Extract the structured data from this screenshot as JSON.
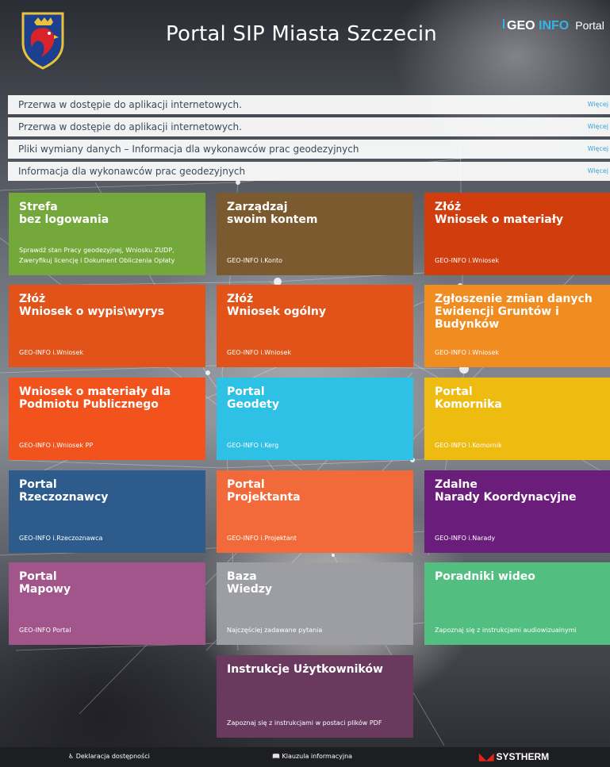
{
  "header": {
    "title": "Portal SIP Miasta Szczecin",
    "brand_geo": "GEO",
    "brand_info": "INFO",
    "brand_portal": "Portal",
    "crest_icon": "szczecin-crest-icon"
  },
  "news": [
    {
      "text": "Przerwa w dostępie do aplikacji internetowych.",
      "more": "Więcej"
    },
    {
      "text": "Przerwa w dostępie do aplikacji internetowych.",
      "more": "Więcej"
    },
    {
      "text": "Pliki wymiany danych – Informacja dla wykonawców prac geodezyjnych",
      "more": "Więcej"
    },
    {
      "text": "Informacja dla wykonawców prac geodezyjnych",
      "more": "Więcej"
    }
  ],
  "tiles": [
    {
      "title": "Strefa\nbez logowania",
      "sub": "Sprawdź stan Pracy geodezyjnej, Wniosku ZUDP, Zweryfikuj licencję i Dokument Obliczenia Opłaty",
      "color": "#74a83a"
    },
    {
      "title": "Zarządzaj\nswoim kontem",
      "sub": "GEO-INFO i.Konto",
      "color": "#7a5a2e"
    },
    {
      "title": "Złóż\nWniosek o materiały",
      "sub": "GEO-INFO i.Wniosek",
      "color": "#d23d0d"
    },
    {
      "title": "Złóż\nWniosek o wypis\\wyrys",
      "sub": "GEO-INFO i.Wniosek",
      "color": "#e2531a"
    },
    {
      "title": "Złóż\nWniosek ogólny",
      "sub": "GEO-INFO i.Wniosek",
      "color": "#e2531a"
    },
    {
      "title": "Zgłoszenie zmian danych\nEwidencji Gruntów i Budynków",
      "sub": "GEO-INFO i.Wniosek",
      "color": "#f08c20"
    },
    {
      "title": "Wniosek o materiały dla\nPodmiotu Publicznego",
      "sub": "GEO-INFO i.Wniosek PP",
      "color": "#f2531d"
    },
    {
      "title": "Portal\nGeodety",
      "sub": "GEO-INFO i.Kerg",
      "color": "#2fc0e6"
    },
    {
      "title": "Portal\nKomornika",
      "sub": "GEO-INFO i.Komornik",
      "color": "#eebc10"
    },
    {
      "title": "Portal\nRzeczoznawcy",
      "sub": "GEO-INFO i.Rzeczoznawca",
      "color": "#2d5c8c"
    },
    {
      "title": "Portal\nProjektanta",
      "sub": "GEO-INFO i.Projektant",
      "color": "#f36a3a"
    },
    {
      "title": "Zdalne\nNarady Koordynacyjne",
      "sub": "GEO-INFO i.Narady",
      "color": "#6a1d7a"
    },
    {
      "title": "Portal\nMapowy",
      "sub": "GEO-INFO Portal",
      "color": "#a2558a"
    },
    {
      "title": "Baza\nWiedzy",
      "sub": "Najczęściej zadawane pytania",
      "color": "#9c9ea4"
    },
    {
      "title": "Poradniki wideo",
      "sub": "Zapoznaj się z instrukcjami audiowizualnymi",
      "color": "#52bf80"
    },
    {
      "title": "Instrukcje Użytkowników",
      "sub": "Zapoznaj się z instrukcjami w postaci plików PDF",
      "color": "#6a3a5e"
    }
  ],
  "footer": {
    "accessibility": "Deklaracja dostępności",
    "accessibility_icon": "wheelchair-icon",
    "clause": "Klauzula informacyjna",
    "clause_icon": "book-icon",
    "vendor": "SYSTHERM"
  }
}
